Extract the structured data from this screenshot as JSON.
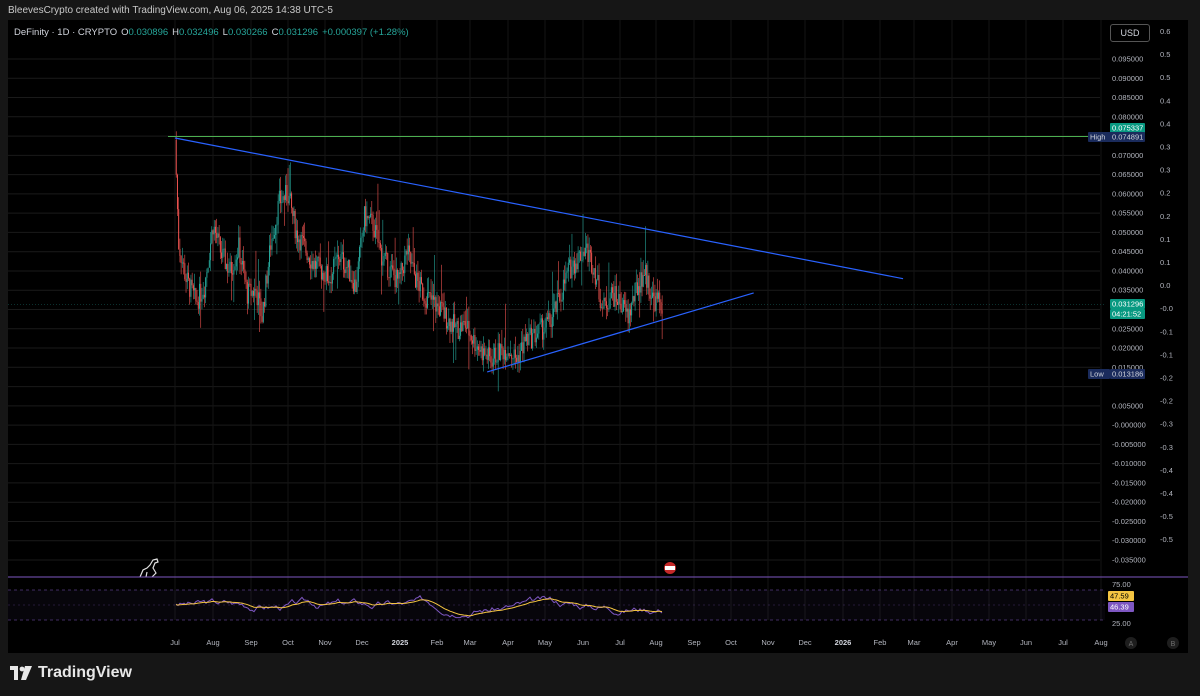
{
  "caption": "BleevesCrypto created with TradingView.com, Aug 06, 2025 14:38 UTC-5",
  "legend": {
    "symbol": "DeFinity · 1D · CRYPTO",
    "o_label": "O",
    "o_value": "0.030896",
    "h_label": "H",
    "h_value": "0.032496",
    "l_label": "L",
    "l_value": "0.030266",
    "c_label": "C",
    "c_value": "0.031296",
    "change": "+0.000397 (+1.28%)"
  },
  "currency_button": "USD",
  "brand": "TradingView",
  "colors": {
    "background": "#000000",
    "frame": "#161616",
    "up_candle": "#26a69a",
    "down_candle": "#ef5350",
    "trendline": "#2962ff",
    "high_line": "#4caf50",
    "rsi_line": "#7e57c2",
    "rsi_ma": "#f5c542",
    "price_tag": "#089981",
    "high_tag": "#1a2b5c",
    "rsi_tag": "#f5c542",
    "rsi_ma_tag": "#7e57c2"
  },
  "price_axis_labels": [
    "0.095000",
    "0.090000",
    "0.085000",
    "0.080000",
    "0.070000",
    "0.065000",
    "0.060000",
    "0.055000",
    "0.050000",
    "0.045000",
    "0.040000",
    "0.035000",
    "0.025000",
    "0.020000",
    "0.015000",
    "0.005000",
    "-0.000000",
    "-0.005000",
    "-0.010000",
    "-0.015000",
    "-0.020000",
    "-0.025000",
    "-0.030000",
    "-0.035000"
  ],
  "right_axis_labels": [
    "0.6",
    "0.5",
    "0.5",
    "0.4",
    "0.4",
    "0.3",
    "0.3",
    "0.2",
    "0.2",
    "0.1",
    "0.1",
    "0.0",
    "-0.0",
    "-0.1",
    "-0.1",
    "-0.2",
    "-0.2",
    "-0.3",
    "-0.3",
    "-0.4",
    "-0.4",
    "-0.5",
    "-0.5"
  ],
  "tags": {
    "high_tag_top": "0.075337",
    "high_label": "High",
    "high_value": "0.074891",
    "price_value": "0.031296",
    "countdown": "04:21:52",
    "low_label": "Low",
    "low_value": "0.013186",
    "rsi_upper": "75.00",
    "rsi_lower": "25.00",
    "rsi_value": "47.59",
    "rsi_ma_value": "46.39"
  },
  "time_axis_labels": [
    "Jul",
    "Aug",
    "Sep",
    "Oct",
    "Nov",
    "Dec",
    "2025",
    "Feb",
    "Mar",
    "Apr",
    "May",
    "Jun",
    "Jul",
    "Aug",
    "Sep",
    "Oct",
    "Nov",
    "Dec",
    "2026",
    "Feb",
    "Mar",
    "Apr",
    "May",
    "Jun",
    "Jul",
    "Aug"
  ],
  "axis_buttons": [
    "A",
    "B"
  ],
  "chart_data": {
    "type": "candlestick",
    "title": "DeFinity · 1D · CRYPTO",
    "y_range": [
      -0.035,
      0.095
    ],
    "high": 0.074891,
    "low": 0.013186,
    "last": 0.031296,
    "trendlines": [
      {
        "name": "",
        "from": {
          "x": "2024-07-01",
          "y": 0.0745
        },
        "to": {
          "x": "2026-02-20",
          "y": 0.038
        }
      },
      {
        "name": "",
        "from": {
          "x": "2025-03-15",
          "y": 0.0138
        },
        "to": {
          "x": "2025-10-20",
          "y": 0.0343
        }
      }
    ],
    "horizontal_lines": [
      {
        "y": 0.0749
      }
    ],
    "price_path": [
      [
        "2024-07-01",
        0.074
      ],
      [
        "2024-07-04",
        0.047
      ],
      [
        "2024-07-10",
        0.038
      ],
      [
        "2024-07-18",
        0.032
      ],
      [
        "2024-07-25",
        0.036
      ],
      [
        "2024-08-01",
        0.052
      ],
      [
        "2024-08-08",
        0.044
      ],
      [
        "2024-08-15",
        0.04
      ],
      [
        "2024-08-22",
        0.046
      ],
      [
        "2024-08-29",
        0.034
      ],
      [
        "2024-09-05",
        0.035
      ],
      [
        "2024-09-10",
        0.028
      ],
      [
        "2024-09-17",
        0.047
      ],
      [
        "2024-09-24",
        0.058
      ],
      [
        "2024-10-01",
        0.06
      ],
      [
        "2024-10-08",
        0.05
      ],
      [
        "2024-10-15",
        0.046
      ],
      [
        "2024-10-22",
        0.042
      ],
      [
        "2024-10-29",
        0.04
      ],
      [
        "2024-11-05",
        0.038
      ],
      [
        "2024-11-12",
        0.044
      ],
      [
        "2024-11-19",
        0.041
      ],
      [
        "2024-11-26",
        0.036
      ],
      [
        "2024-12-03",
        0.054
      ],
      [
        "2024-12-10",
        0.052
      ],
      [
        "2024-12-17",
        0.044
      ],
      [
        "2024-12-24",
        0.04
      ],
      [
        "2024-12-31",
        0.037
      ],
      [
        "2025-01-07",
        0.045
      ],
      [
        "2025-01-14",
        0.038
      ],
      [
        "2025-01-21",
        0.034
      ],
      [
        "2025-01-28",
        0.032
      ],
      [
        "2025-02-04",
        0.03
      ],
      [
        "2025-02-11",
        0.027
      ],
      [
        "2025-02-18",
        0.025
      ],
      [
        "2025-02-25",
        0.026
      ],
      [
        "2025-03-04",
        0.022
      ],
      [
        "2025-03-11",
        0.019
      ],
      [
        "2025-03-18",
        0.017
      ],
      [
        "2025-03-25",
        0.019
      ],
      [
        "2025-04-01",
        0.02
      ],
      [
        "2025-04-08",
        0.017
      ],
      [
        "2025-04-15",
        0.022
      ],
      [
        "2025-04-22",
        0.023
      ],
      [
        "2025-04-29",
        0.025
      ],
      [
        "2025-05-06",
        0.027
      ],
      [
        "2025-05-13",
        0.033
      ],
      [
        "2025-05-20",
        0.04
      ],
      [
        "2025-05-27",
        0.043
      ],
      [
        "2025-06-03",
        0.046
      ],
      [
        "2025-06-10",
        0.041
      ],
      [
        "2025-06-17",
        0.03
      ],
      [
        "2025-06-24",
        0.034
      ],
      [
        "2025-07-01",
        0.032
      ],
      [
        "2025-07-08",
        0.028
      ],
      [
        "2025-07-15",
        0.035
      ],
      [
        "2025-07-22",
        0.04
      ],
      [
        "2025-07-29",
        0.033
      ],
      [
        "2025-08-06",
        0.031296
      ]
    ],
    "rsi": {
      "upper": 75,
      "lower": 25,
      "value": 47.59,
      "ma": 46.39
    }
  }
}
